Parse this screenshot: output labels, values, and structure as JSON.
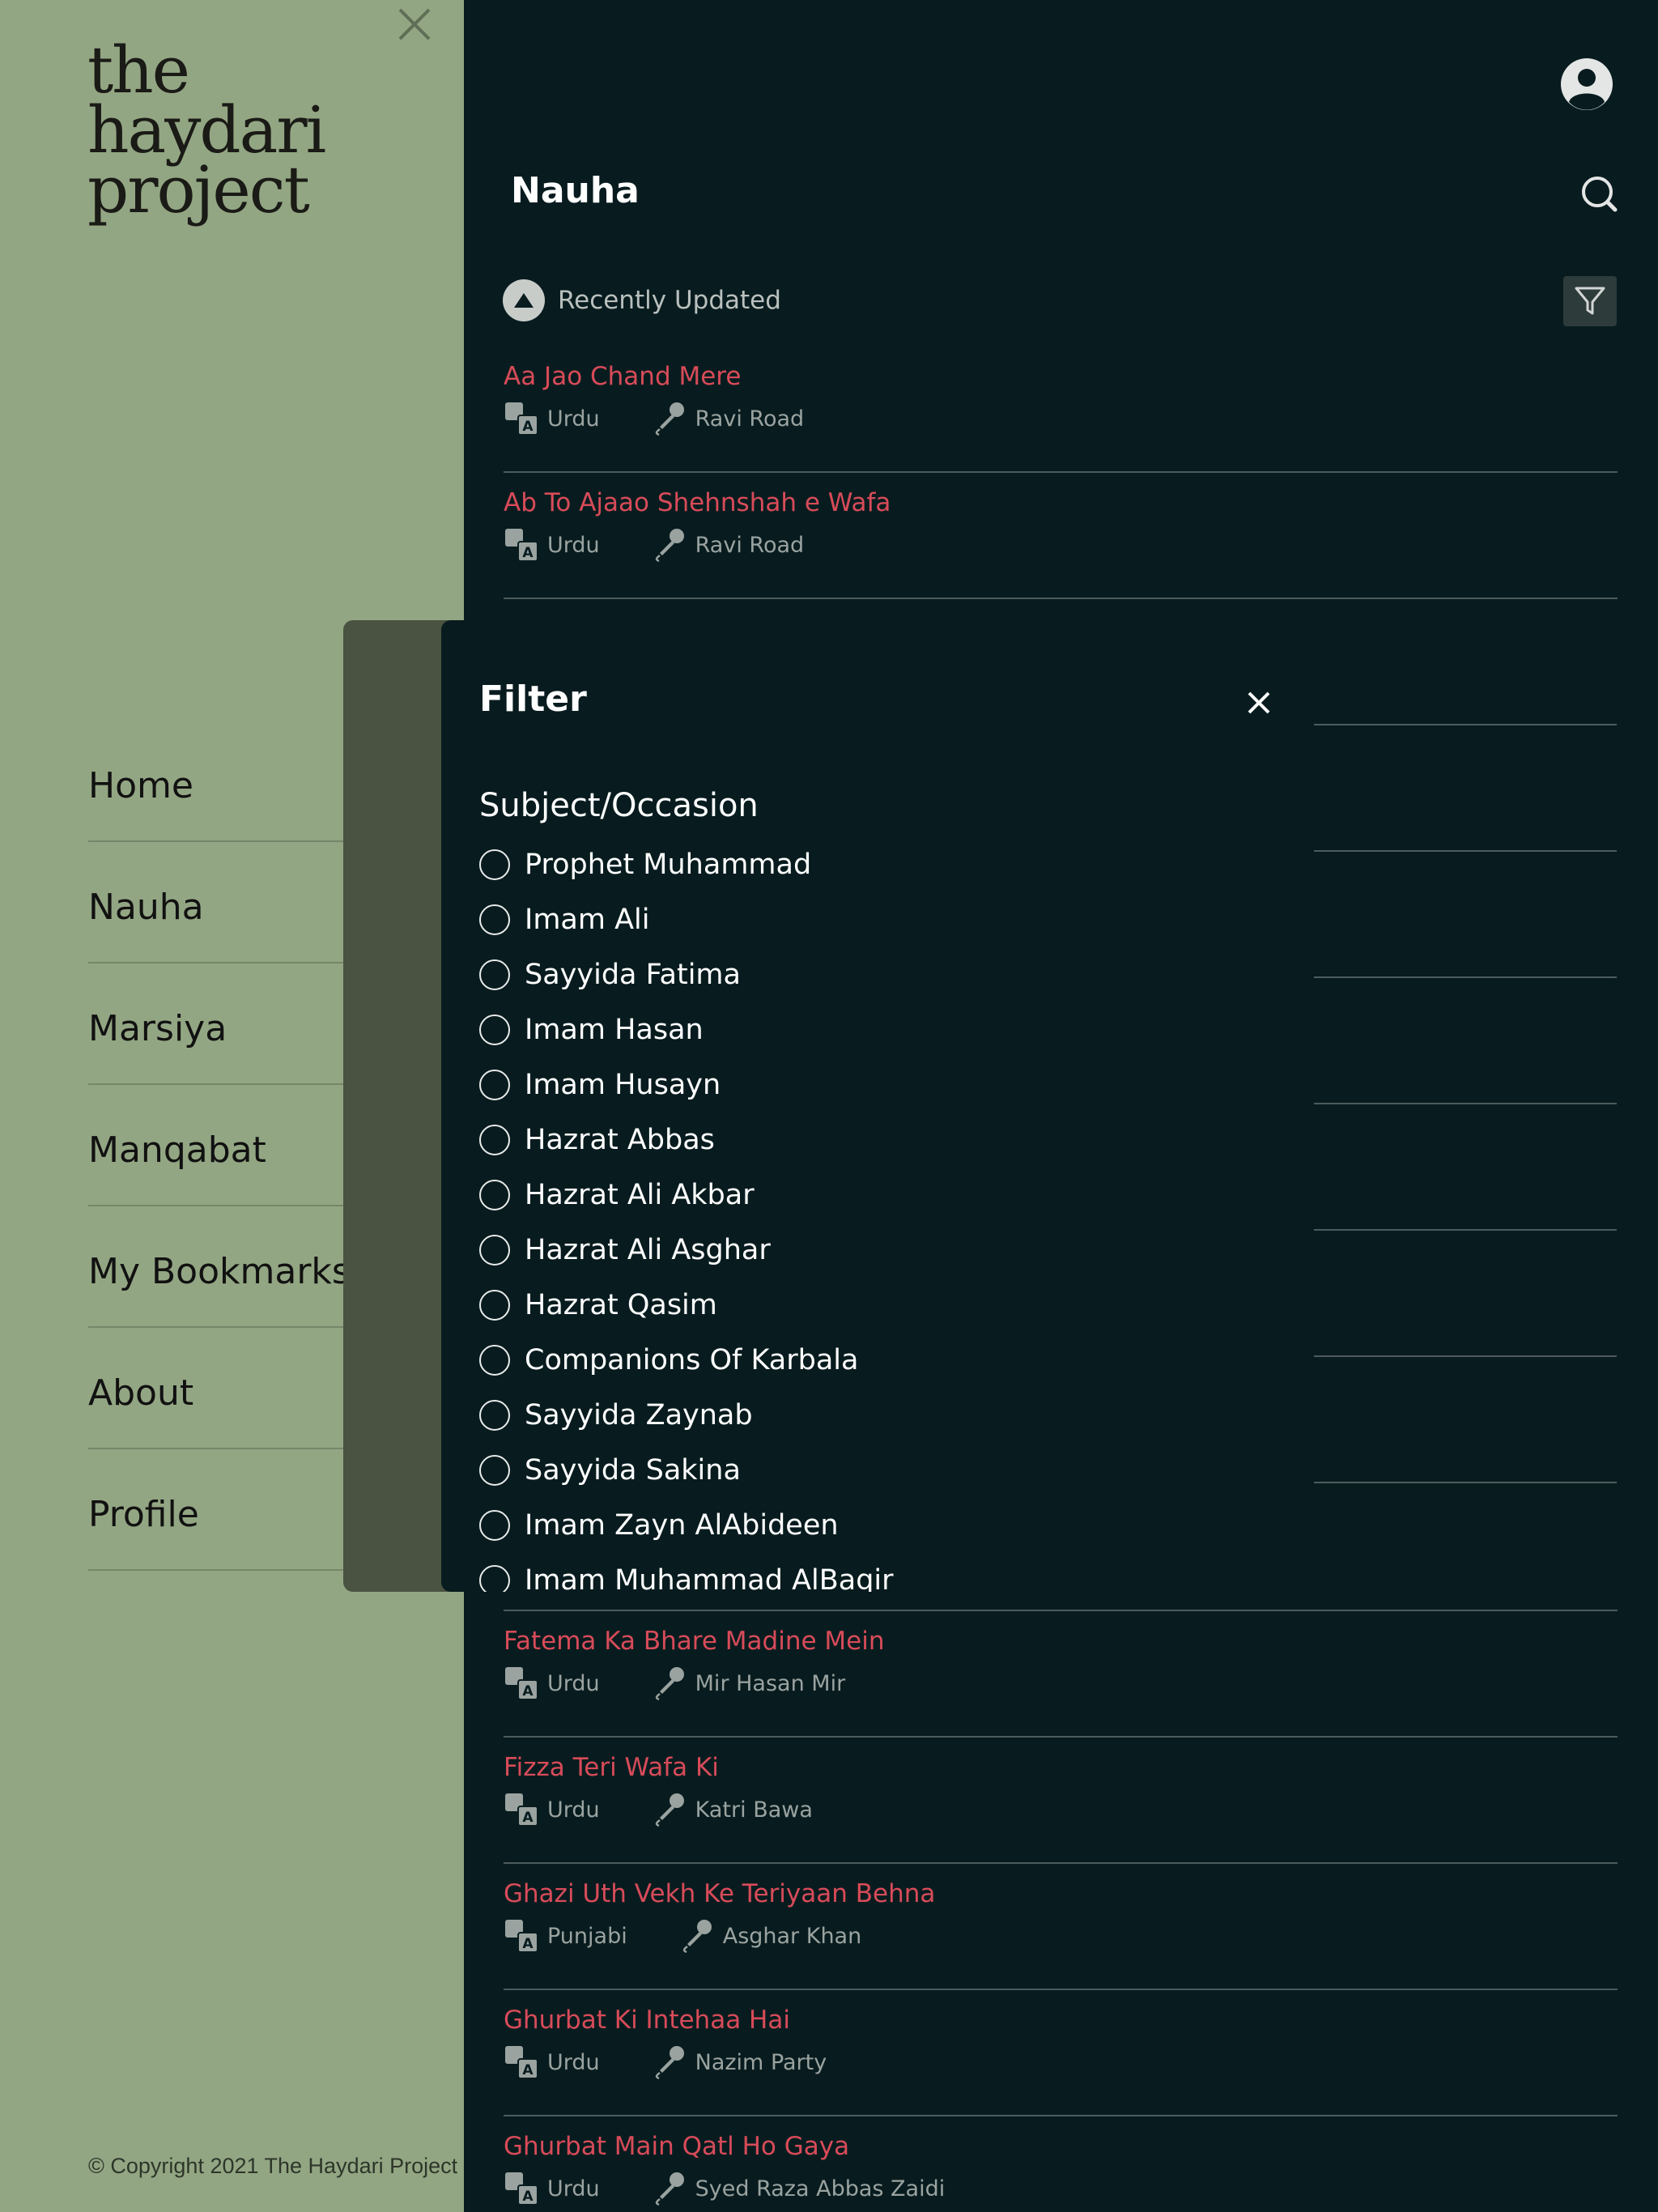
{
  "colors": {
    "sidebar_bg": "#93a683",
    "main_bg": "#081c1f",
    "song_title": "#d84b59",
    "meta_text": "#9aa3a0",
    "divider": "#4d5b5c"
  },
  "sidebar": {
    "logo": {
      "line1": "the",
      "line2": "haydari",
      "line3": "project"
    },
    "nav": [
      {
        "label": "Home"
      },
      {
        "label": "Nauha"
      },
      {
        "label": "Marsiya"
      },
      {
        "label": "Manqabat"
      },
      {
        "label": "My Bookmarks"
      },
      {
        "label": "About"
      },
      {
        "label": "Profile"
      }
    ],
    "copyright": "© Copyright 2021 The Haydari Project"
  },
  "header": {
    "title": "Nauha",
    "sort_label": "Recently Updated"
  },
  "songs_top": [
    {
      "title": "Aa Jao Chand Mere",
      "language": "Urdu",
      "reciter": "Ravi Road"
    },
    {
      "title": "Ab To Ajaao Shehnshah e Wafa",
      "language": "Urdu",
      "reciter": "Ravi Road"
    }
  ],
  "songs_bottom": [
    {
      "title": "Fatema Ka Bhare Madine Mein",
      "language": "Urdu",
      "reciter": "Mir Hasan Mir"
    },
    {
      "title": "Fizza Teri Wafa Ki",
      "language": "Urdu",
      "reciter": "Katri Bawa"
    },
    {
      "title": "Ghazi Uth Vekh Ke Teriyaan Behna",
      "language": "Punjabi",
      "reciter": "Asghar Khan"
    },
    {
      "title": "Ghurbat Ki Intehaa Hai",
      "language": "Urdu",
      "reciter": "Nazim Party"
    },
    {
      "title": "Ghurbat Main Qatl Ho Gaya",
      "language": "Urdu",
      "reciter": "Syed Raza Abbas Zaidi"
    }
  ],
  "filter": {
    "title": "Filter",
    "section_title": "Subject/Occasion",
    "options": [
      "Prophet Muhammad",
      "Imam Ali",
      "Sayyida Fatima",
      "Imam Hasan",
      "Imam Husayn",
      "Hazrat Abbas",
      "Hazrat Ali Akbar",
      "Hazrat Ali Asghar",
      "Hazrat Qasim",
      "Companions Of Karbala",
      "Sayyida Zaynab",
      "Sayyida Sakina",
      "Imam Zayn AlAbideen",
      "Imam Muhammad AlBaqir"
    ]
  },
  "icons": {
    "language": "translate-icon",
    "reciter": "microphone-icon",
    "sort": "triangle-up-icon",
    "filter": "funnel-icon",
    "search": "search-icon",
    "profile": "user-avatar-icon",
    "close": "close-icon"
  }
}
